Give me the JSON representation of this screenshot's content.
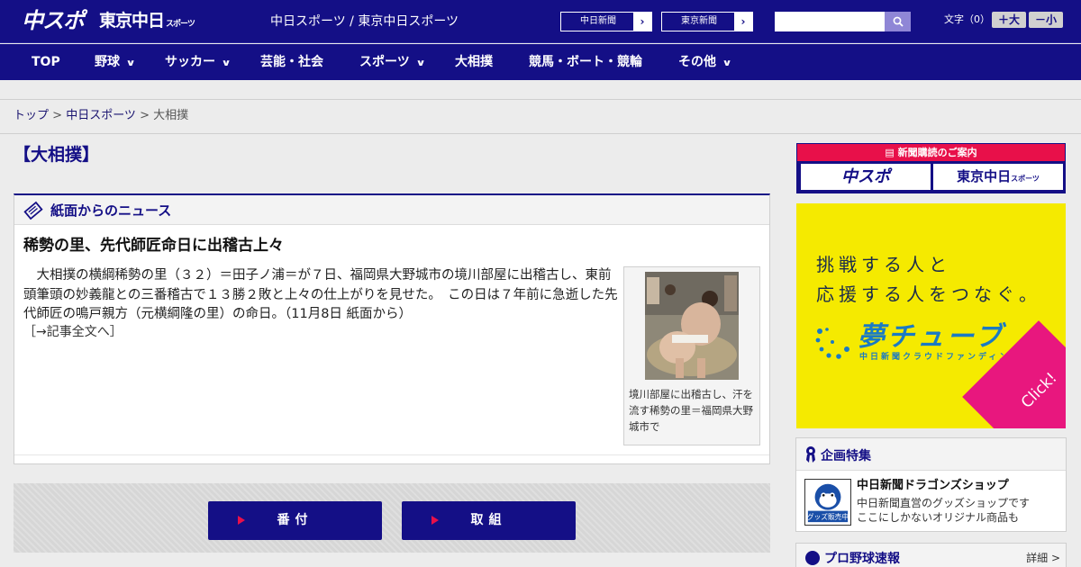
{
  "header": {
    "logo_chunichi": "中スポ",
    "logo_tokyo": "東京中日",
    "logo_tokyo_sub": "スポーツ",
    "site_title": "中日スポーツ / 東京中日スポーツ",
    "paper_links": [
      {
        "label": "中日新聞",
        "arrow": "›"
      },
      {
        "label": "東京新聞",
        "arrow": "›"
      }
    ],
    "search": {
      "placeholder": "",
      "value": ""
    },
    "font_size_label": "文字（0）",
    "font_larger": "＋大",
    "font_smaller": "－小"
  },
  "nav": {
    "items": [
      {
        "label": "TOP",
        "has_menu": false
      },
      {
        "label": "野球",
        "has_menu": true
      },
      {
        "label": "サッカー",
        "has_menu": true
      },
      {
        "label": "芸能・社会",
        "has_menu": false
      },
      {
        "label": "スポーツ",
        "has_menu": true
      },
      {
        "label": "大相撲",
        "has_menu": false
      },
      {
        "label": "競馬・ボート・競輪",
        "has_menu": false
      },
      {
        "label": "その他",
        "has_menu": true
      }
    ]
  },
  "breadcrumb": {
    "home": "トップ",
    "sep": " > ",
    "section": "中日スポーツ",
    "current": "大相撲"
  },
  "page_title": "【大相撲】",
  "news": {
    "heading": "紙面からのニュース",
    "article_title": "稀勢の里、先代師匠命日に出稽古上々",
    "body": "　大相撲の横綱稀勢の里（３２）＝田子ノ浦＝が７日、福岡県大野城市の境川部屋に出稽古し、東前頭筆頭の妙義龍との三番稽古で１３勝２敗と上々の仕上がりを見せた。　この日は７年前に急逝した先代師匠の鳴戸親方（元横綱隆の里）の命日。（11月8日 紙面から）",
    "more_link": "［→記事全文へ］",
    "photo_caption": "境川部屋に出稽古し、汗を流す稀勢の里＝福岡県大野城市で"
  },
  "buttons": {
    "banzuke": "番付",
    "torikumi": "取組"
  },
  "sidebar": {
    "subscribe_heading": "新聞購読のご案内",
    "subscribe_logo1": "中スポ",
    "subscribe_logo2": "東京中日",
    "subscribe_logo2_sub": "スポーツ",
    "ad": {
      "line1": "挑戦する人と",
      "line2": "応援する人をつなぐ。",
      "brand": "夢チューブ",
      "sub": "中日新聞クラウドファンディング",
      "click": "Click!"
    },
    "feature": {
      "heading": "企画特集",
      "shop_name": "中日新聞ドラゴンズショップ",
      "shop_desc1": "中日新聞直営のグッズショップです",
      "shop_desc2": "ここにしかないオリジナル商品も",
      "shop_badge": "グッズ販売中"
    },
    "baseball": {
      "heading": "プロ野球速報",
      "more": "詳細 >"
    }
  },
  "colors": {
    "brand_navy": "#140f86",
    "accent_pink": "#e8104a",
    "ad_yellow": "#f5ea00",
    "ad_blue": "#1a7ac4",
    "ad_magenta": "#e8177e"
  }
}
